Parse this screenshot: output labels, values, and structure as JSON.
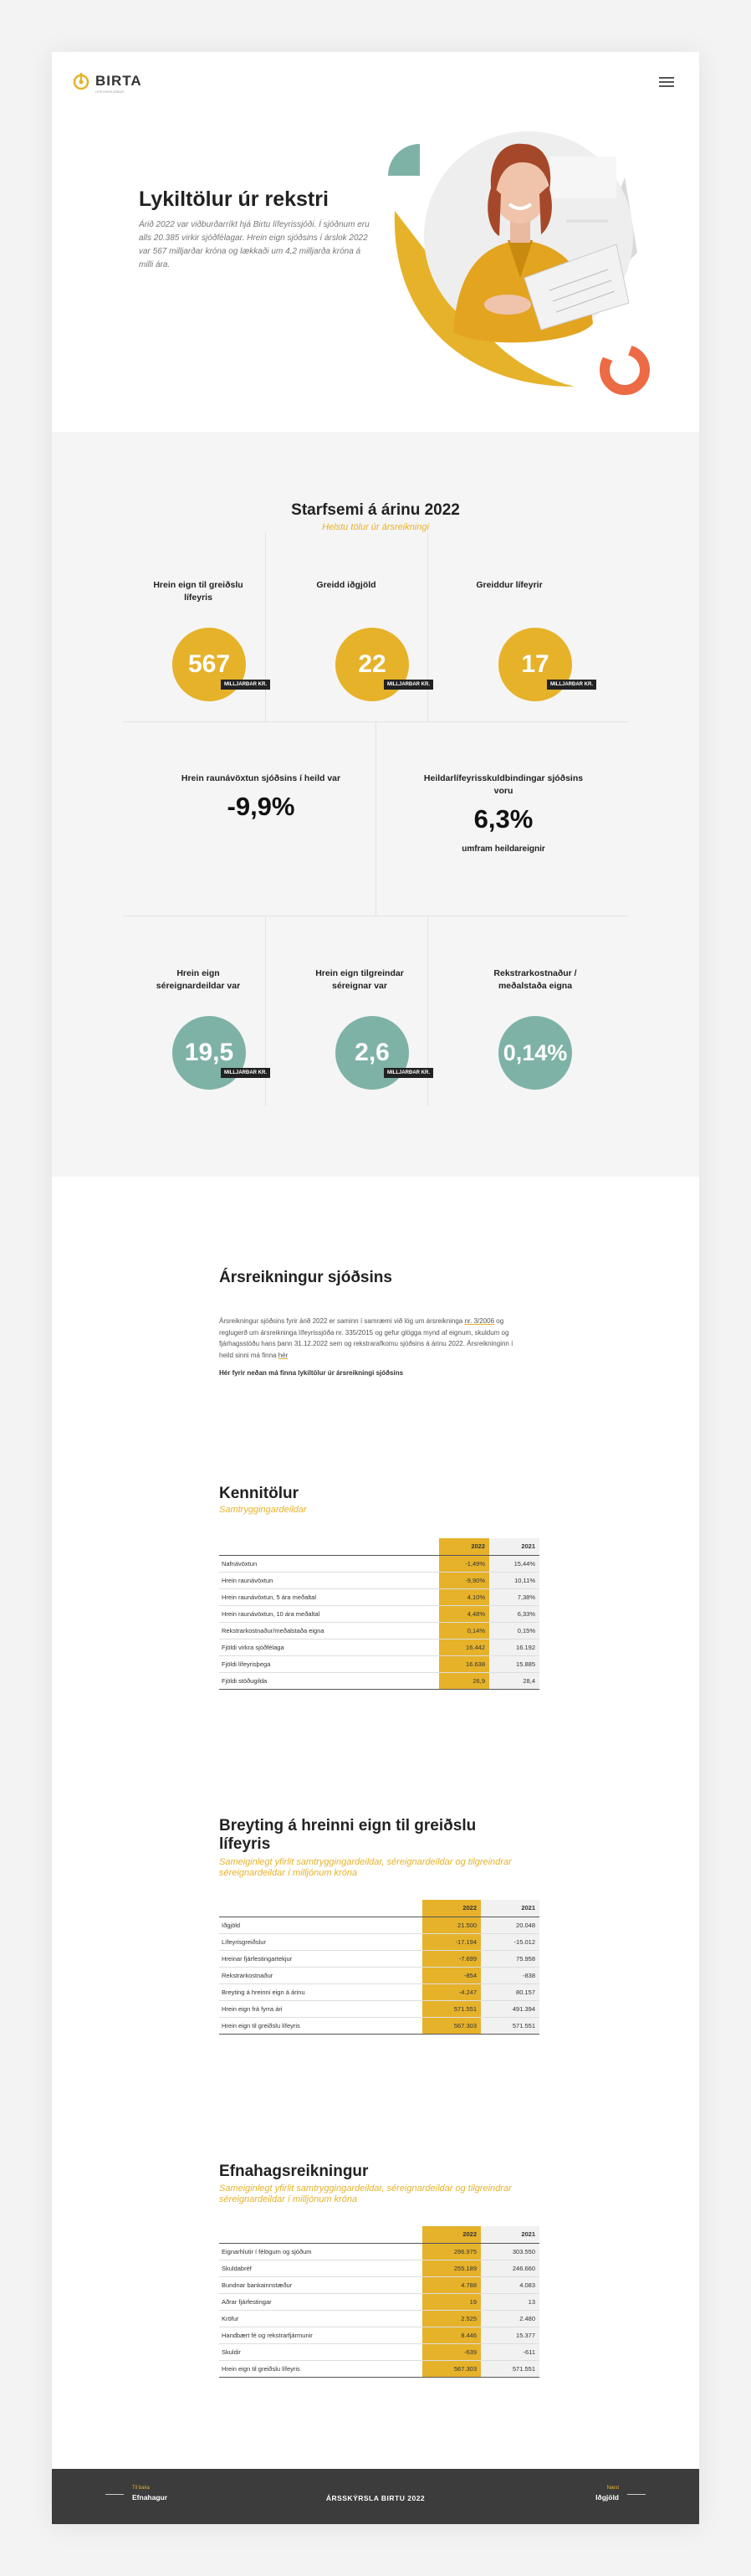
{
  "header": {
    "logo_text": "BIRTA",
    "logo_sub": "LÍFEYRISSJÓÐUR"
  },
  "hero": {
    "title": "Lykiltölur úr rekstri",
    "text": "Árið 2022 var viðburðarríkt hjá Birtu lífeyrissjóði. Í sjóðnum eru alls 20.385 virkir sjóðfélagar. Hrein eign sjóðsins í árslok 2022 var 567 milljarðar króna og lækkaði um 4,2 milljarða króna á milli ára."
  },
  "stats": {
    "title": "Starfsemi á árinu 2022",
    "subtitle": "Helstu tölur úr ársreikningi",
    "row1": [
      {
        "label": "Hrein eign til greiðslu lífeyris",
        "value": "567",
        "unit": "MILLJARÐAR KR."
      },
      {
        "label": "Greidd iðgjöld",
        "value": "22",
        "unit": "MILLJARÐAR KR."
      },
      {
        "label": "Greiddur lífeyrir",
        "value": "17",
        "unit": "MILLJARÐAR KR."
      }
    ],
    "row2": [
      {
        "label": "Hrein raunávöxtun sjóðsins í heild var",
        "value": "-9,9%"
      },
      {
        "label": "Heildarlífeyrisskuldbindingar sjóðsins voru",
        "value": "6,3%",
        "note": "umfram heildareignir"
      }
    ],
    "row3": [
      {
        "label": "Hrein eign séreignardeildar var",
        "value": "19,5",
        "unit": "MILLJARÐAR KR."
      },
      {
        "label": "Hrein eign tilgreindar séreignar var",
        "value": "2,6",
        "unit": "MILLJARÐAR KR."
      },
      {
        "label": "Rekstrarkostnaður / meðalstaða eigna",
        "value": "0,14%"
      }
    ]
  },
  "report": {
    "title": "Ársreikningur sjóðsins",
    "p_part1": "Ársreikningur sjóðsins fyrir árið 2022 er saminn í samræmi við lög um ársreikninga ",
    "p_link1": "nr. 3/2006",
    "p_part2": " og reglugerð um ársreikninga lífeyrissjóða nr. 335/2015 og gefur glögga mynd af eignum, skuldum og fjárhagsstöðu hans þann 31.12.2022 sem og rekstrarafkomu sjóðsins á árinu 2022. Ársreikninginn í heild sinni má finna ",
    "p_link2": "hér",
    "p_part3": "",
    "link_text": "Hér fyrir neðan má finna lykiltölur úr ársreikningi sjóðsins"
  },
  "kennitolur": {
    "title": "Kennitölur",
    "subtitle": "Samtryggingardeildar",
    "col1": "2022",
    "col2": "2021",
    "rows": [
      [
        "Nafnávöxtun",
        "-1,49%",
        "15,44%"
      ],
      [
        "Hrein raunávöxtun",
        "-9,90%",
        "10,11%"
      ],
      [
        "Hrein raunávöxtun, 5 ára meðaltal",
        "4,10%",
        "7,38%"
      ],
      [
        "Hrein raunávöxtun, 10 ára meðaltal",
        "4,48%",
        "6,33%"
      ],
      [
        "Rekstrarkostnaður/meðalstaða eigna",
        "0,14%",
        "0,15%"
      ],
      [
        "Fjöldi virkra sjóðfélaga",
        "16.442",
        "16.192"
      ],
      [
        "Fjöldi lífeyrisþega",
        "16.638",
        "15.885"
      ],
      [
        "Fjöldi stöðugilda",
        "26,9",
        "28,4"
      ]
    ]
  },
  "breyting": {
    "title": "Breyting á hreinni eign til greiðslu lífeyris",
    "subtitle": "Sameiginlegt yfirlit samtryggingardeildar, séreignardeildar og tilgreindrar séreignardeildar í milljónum króna",
    "col1": "2022",
    "col2": "2021",
    "rows": [
      [
        "Iðgjöld",
        "21.500",
        "20.048"
      ],
      [
        "Lífeyrisgreiðslur",
        "-17.194",
        "-15.012"
      ],
      [
        "Hreinar fjárfestingartekjur",
        "-7.699",
        "75.958"
      ],
      [
        "Rekstrarkostnaður",
        "-854",
        "-838"
      ],
      [
        "Breyting á hreinni eign á árinu",
        "-4.247",
        "80.157"
      ],
      [
        "Hrein eign frá fyrra ári",
        "571.551",
        "491.394"
      ],
      [
        "Hrein eign til greiðslu lífeyris",
        "567.303",
        "571.551"
      ]
    ]
  },
  "efnahagur": {
    "title": "Efnahagsreikningur",
    "subtitle": "Sameiginlegt yfirlit samtryggingardeildar, séreignardeildar og tilgreindrar séreignardeildar í milljónum króna",
    "col1": "2022",
    "col2": "2021",
    "rows": [
      [
        "Eignarhlutir í félögum og sjóðum",
        "296.975",
        "303.550"
      ],
      [
        "Skuldabréf",
        "255.189",
        "246.660"
      ],
      [
        "Bundnar bankainnstæður",
        "4.788",
        "4.083"
      ],
      [
        "Aðrar fjárfestingar",
        "19",
        "13"
      ],
      [
        "Kröfur",
        "2.525",
        "2.480"
      ],
      [
        "Handbært fé og rekstrarfjármunir",
        "8.446",
        "15.377"
      ],
      [
        "Skuldir",
        "-639",
        "-611"
      ],
      [
        "Hrein eign til greiðslu lífeyris",
        "567.303",
        "571.551"
      ]
    ]
  },
  "footer": {
    "prev_small": "Til baka",
    "prev_label": "Efnahagur",
    "center": "ÁRSSKÝRSLA BIRTU 2022",
    "next_small": "Næst",
    "next_label": "Iðgjöld"
  },
  "colors": {
    "accent": "#e6b22a",
    "teal": "#7fb2a6",
    "coral": "#ec6a44",
    "footer": "#3c3c3c"
  }
}
